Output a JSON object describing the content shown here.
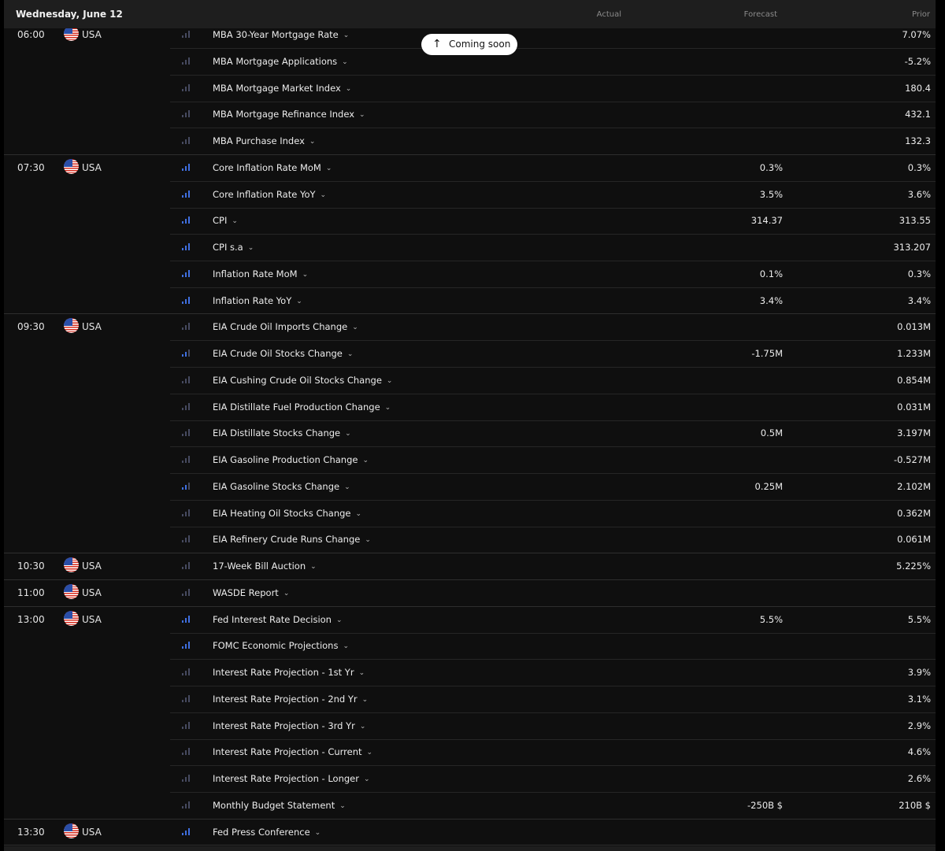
{
  "header": {
    "date": "Wednesday, June 12",
    "actual_label": "Actual",
    "forecast_label": "Forecast",
    "prior_label": "Prior"
  },
  "toast": {
    "icon": "arrow-up-icon",
    "label": "Coming soon"
  },
  "colors": {
    "background": "#0f0f0f",
    "header": "#1e1e1e",
    "importance_high": "#3f6fe0",
    "importance_low": "#464a60"
  },
  "groups": [
    {
      "time": "06:00",
      "country": "USA",
      "events": [
        {
          "name": "MBA 30-Year Mortgage Rate",
          "importance": 1,
          "actual": "",
          "forecast": "",
          "prior": "7.07%"
        },
        {
          "name": "MBA Mortgage Applications",
          "importance": 1,
          "actual": "",
          "forecast": "",
          "prior": "-5.2%"
        },
        {
          "name": "MBA Mortgage Market Index",
          "importance": 1,
          "actual": "",
          "forecast": "",
          "prior": "180.4"
        },
        {
          "name": "MBA Mortgage Refinance Index",
          "importance": 1,
          "actual": "",
          "forecast": "",
          "prior": "432.1"
        },
        {
          "name": "MBA Purchase Index",
          "importance": 1,
          "actual": "",
          "forecast": "",
          "prior": "132.3"
        }
      ]
    },
    {
      "time": "07:30",
      "country": "USA",
      "events": [
        {
          "name": "Core Inflation Rate MoM",
          "importance": 3,
          "actual": "",
          "forecast": "0.3%",
          "prior": "0.3%"
        },
        {
          "name": "Core Inflation Rate YoY",
          "importance": 3,
          "actual": "",
          "forecast": "3.5%",
          "prior": "3.6%"
        },
        {
          "name": "CPI",
          "importance": 3,
          "actual": "",
          "forecast": "314.37",
          "prior": "313.55"
        },
        {
          "name": "CPI s.a",
          "importance": 3,
          "actual": "",
          "forecast": "",
          "prior": "313.207"
        },
        {
          "name": "Inflation Rate MoM",
          "importance": 3,
          "actual": "",
          "forecast": "0.1%",
          "prior": "0.3%"
        },
        {
          "name": "Inflation Rate YoY",
          "importance": 3,
          "actual": "",
          "forecast": "3.4%",
          "prior": "3.4%"
        }
      ]
    },
    {
      "time": "09:30",
      "country": "USA",
      "events": [
        {
          "name": "EIA Crude Oil Imports Change",
          "importance": 1,
          "actual": "",
          "forecast": "",
          "prior": "0.013M"
        },
        {
          "name": "EIA Crude Oil Stocks Change",
          "importance": 2,
          "actual": "",
          "forecast": "-1.75M",
          "prior": "1.233M"
        },
        {
          "name": "EIA Cushing Crude Oil Stocks Change",
          "importance": 1,
          "actual": "",
          "forecast": "",
          "prior": "0.854M"
        },
        {
          "name": "EIA Distillate Fuel Production Change",
          "importance": 1,
          "actual": "",
          "forecast": "",
          "prior": "0.031M"
        },
        {
          "name": "EIA Distillate Stocks Change",
          "importance": 1,
          "actual": "",
          "forecast": "0.5M",
          "prior": "3.197M"
        },
        {
          "name": "EIA Gasoline Production Change",
          "importance": 1,
          "actual": "",
          "forecast": "",
          "prior": "-0.527M"
        },
        {
          "name": "EIA Gasoline Stocks Change",
          "importance": 2,
          "actual": "",
          "forecast": "0.25M",
          "prior": "2.102M"
        },
        {
          "name": "EIA Heating Oil Stocks Change",
          "importance": 1,
          "actual": "",
          "forecast": "",
          "prior": "0.362M"
        },
        {
          "name": "EIA Refinery Crude Runs Change",
          "importance": 1,
          "actual": "",
          "forecast": "",
          "prior": "0.061M"
        }
      ]
    },
    {
      "time": "10:30",
      "country": "USA",
      "events": [
        {
          "name": "17-Week Bill Auction",
          "importance": 1,
          "actual": "",
          "forecast": "",
          "prior": "5.225%"
        }
      ]
    },
    {
      "time": "11:00",
      "country": "USA",
      "events": [
        {
          "name": "WASDE Report",
          "importance": 1,
          "actual": "",
          "forecast": "",
          "prior": ""
        }
      ]
    },
    {
      "time": "13:00",
      "country": "USA",
      "events": [
        {
          "name": "Fed Interest Rate Decision",
          "importance": 3,
          "actual": "",
          "forecast": "5.5%",
          "prior": "5.5%"
        },
        {
          "name": "FOMC Economic Projections",
          "importance": 3,
          "actual": "",
          "forecast": "",
          "prior": ""
        },
        {
          "name": "Interest Rate Projection - 1st Yr",
          "importance": 1,
          "actual": "",
          "forecast": "",
          "prior": "3.9%"
        },
        {
          "name": "Interest Rate Projection - 2nd Yr",
          "importance": 1,
          "actual": "",
          "forecast": "",
          "prior": "3.1%"
        },
        {
          "name": "Interest Rate Projection - 3rd Yr",
          "importance": 1,
          "actual": "",
          "forecast": "",
          "prior": "2.9%"
        },
        {
          "name": "Interest Rate Projection - Current",
          "importance": 1,
          "actual": "",
          "forecast": "",
          "prior": "4.6%"
        },
        {
          "name": "Interest Rate Projection - Longer",
          "importance": 1,
          "actual": "",
          "forecast": "",
          "prior": "2.6%"
        },
        {
          "name": "Monthly Budget Statement",
          "importance": 1,
          "actual": "",
          "forecast": "-250B $",
          "prior": "210B $"
        }
      ]
    },
    {
      "time": "13:30",
      "country": "USA",
      "events": [
        {
          "name": "Fed Press Conference",
          "importance": 3,
          "actual": "",
          "forecast": "",
          "prior": ""
        }
      ]
    }
  ]
}
